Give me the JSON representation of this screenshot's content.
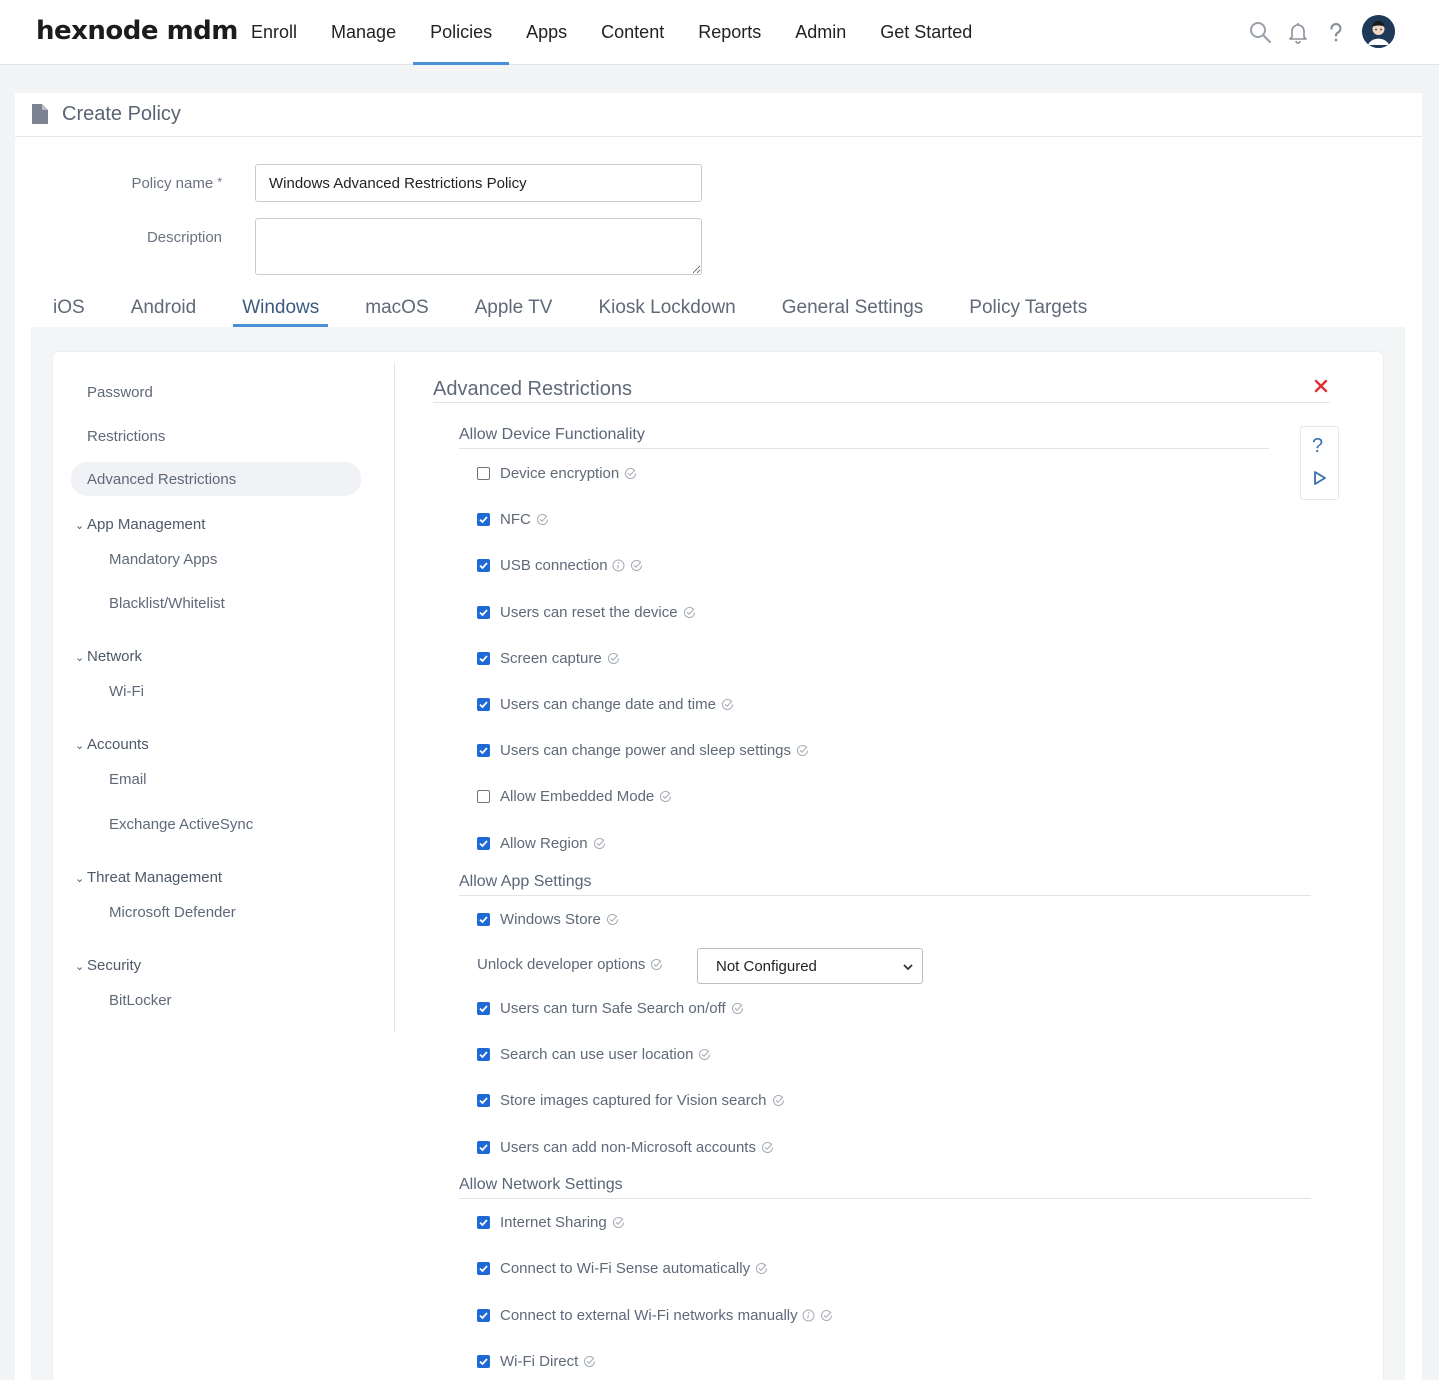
{
  "brand": "hexnode mdm",
  "nav": {
    "items": [
      "Enroll",
      "Manage",
      "Policies",
      "Apps",
      "Content",
      "Reports",
      "Admin",
      "Get Started"
    ],
    "active": "Policies"
  },
  "header": {
    "title": "Create Policy"
  },
  "form": {
    "policy_name_label": "Policy name",
    "required_mark": "*",
    "policy_name_value": "Windows Advanced Restrictions Policy",
    "description_label": "Description",
    "description_value": ""
  },
  "os_tabs": {
    "items": [
      "iOS",
      "Android",
      "Windows",
      "macOS",
      "Apple TV",
      "Kiosk Lockdown",
      "General Settings",
      "Policy Targets"
    ],
    "active": "Windows"
  },
  "sidebar": {
    "password": "Password",
    "restrictions": "Restrictions",
    "advanced_restrictions": "Advanced Restrictions",
    "app_management": "App Management",
    "mandatory_apps": "Mandatory Apps",
    "blacklist_whitelist": "Blacklist/Whitelist",
    "network": "Network",
    "wifi": "Wi-Fi",
    "accounts": "Accounts",
    "email": "Email",
    "exchange_activesync": "Exchange ActiveSync",
    "threat_management": "Threat Management",
    "microsoft_defender": "Microsoft Defender",
    "security": "Security",
    "bitlocker": "BitLocker"
  },
  "content": {
    "title": "Advanced Restrictions",
    "sections": {
      "device": {
        "title": "Allow Device Functionality",
        "items": [
          {
            "label": "Device encryption",
            "checked": false
          },
          {
            "label": "NFC",
            "checked": true
          },
          {
            "label": "USB connection",
            "checked": true,
            "info": true
          },
          {
            "label": "Users can reset the device",
            "checked": true
          },
          {
            "label": "Screen capture",
            "checked": true
          },
          {
            "label": "Users can change date and time",
            "checked": true
          },
          {
            "label": "Users can change power and sleep settings",
            "checked": true
          },
          {
            "label": "Allow Embedded Mode",
            "checked": false
          },
          {
            "label": "Allow Region",
            "checked": true
          }
        ]
      },
      "app": {
        "title": "Allow App Settings",
        "windows_store": "Windows Store",
        "unlock_dev_label": "Unlock developer options",
        "unlock_dev_value": "Not Configured",
        "items": [
          {
            "label": "Users can turn Safe Search on/off",
            "checked": true
          },
          {
            "label": "Search can use user location",
            "checked": true
          },
          {
            "label": "Store images captured for Vision search",
            "checked": true
          },
          {
            "label": "Users can add non-Microsoft accounts",
            "checked": true
          }
        ]
      },
      "network": {
        "title": "Allow Network Settings",
        "items": [
          {
            "label": "Internet Sharing",
            "checked": true
          },
          {
            "label": "Connect to Wi-Fi Sense automatically",
            "checked": true
          },
          {
            "label": "Connect to external Wi-Fi networks manually",
            "checked": true,
            "info": true
          },
          {
            "label": "Wi-Fi Direct",
            "checked": true
          }
        ]
      }
    }
  },
  "help": {
    "question": "?"
  },
  "colors": {
    "accent": "#4a90d9",
    "checkbox": "#1d6ad6",
    "close": "#e0302f"
  }
}
